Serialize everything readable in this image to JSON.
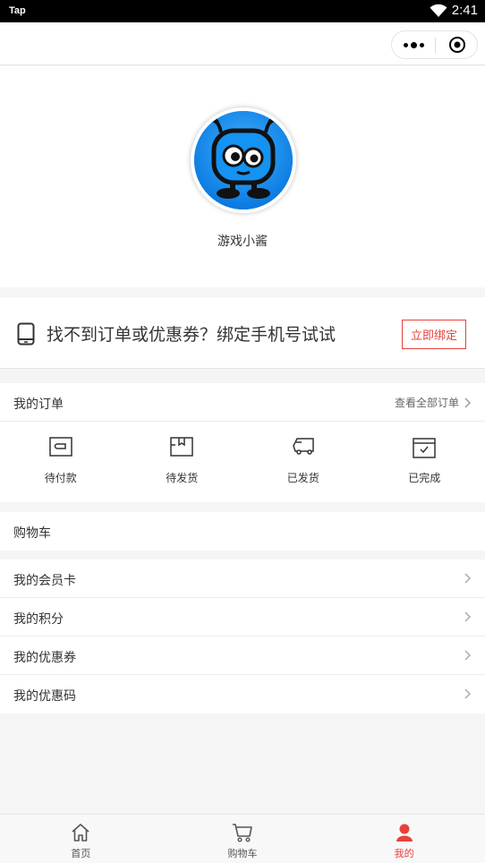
{
  "status_bar": {
    "carrier": "Tap",
    "time": "2:41"
  },
  "profile": {
    "nickname": "游戏小酱"
  },
  "bind_phone": {
    "text": "找不到订单或优惠券？绑定手机号试试",
    "button": "立即绑定"
  },
  "orders": {
    "title": "我的订单",
    "view_all": "查看全部订单",
    "items": [
      {
        "label": "待付款",
        "icon": "wallet-icon"
      },
      {
        "label": "待发货",
        "icon": "package-icon"
      },
      {
        "label": "已发货",
        "icon": "truck-icon"
      },
      {
        "label": "已完成",
        "icon": "calendar-check-icon"
      }
    ]
  },
  "cart": {
    "title": "购物车"
  },
  "menu": [
    {
      "label": "我的会员卡"
    },
    {
      "label": "我的积分"
    },
    {
      "label": "我的优惠券"
    },
    {
      "label": "我的优惠码"
    }
  ],
  "tabbar": [
    {
      "label": "首页",
      "icon": "home-icon",
      "active": false
    },
    {
      "label": "购物车",
      "icon": "cart-icon",
      "active": false
    },
    {
      "label": "我的",
      "icon": "user-icon",
      "active": true
    }
  ],
  "colors": {
    "accent": "#e8413c",
    "avatar_bg": "#1a8ff0"
  }
}
